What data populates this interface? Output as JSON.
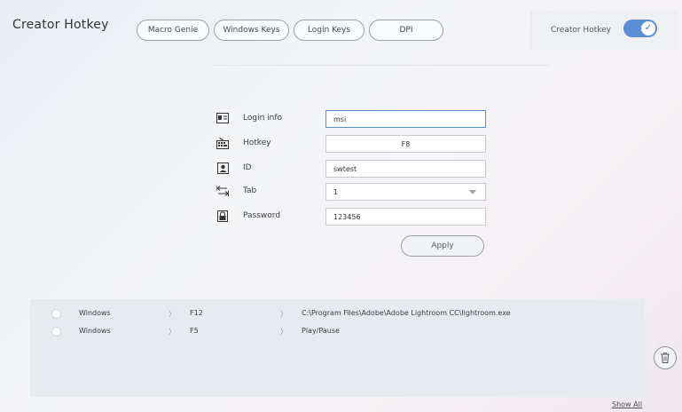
{
  "app": {
    "title": "Creator Hotkey"
  },
  "tabs": [
    {
      "label": "Macro Genie"
    },
    {
      "label": "Windows Keys"
    },
    {
      "label": "Login Keys"
    },
    {
      "label": "DPI"
    }
  ],
  "creator_toggle": {
    "label": "Creator Hotkey",
    "enabled": true,
    "check_glyph": "✓",
    "accent": "#5a8fd6"
  },
  "form": {
    "login_info": {
      "label": "Login info",
      "value": "msi",
      "icon": "id-card-icon"
    },
    "hotkey": {
      "label": "Hotkey",
      "value": "F8",
      "icon": "keyboard-icon"
    },
    "id": {
      "label": "ID",
      "value": "swtest",
      "icon": "user-icon"
    },
    "tab": {
      "label": "Tab",
      "value": "1",
      "icon": "tab-arrows-icon"
    },
    "password": {
      "label": "Password",
      "value": "123456",
      "icon": "lock-icon"
    },
    "apply_label": "Apply"
  },
  "list": {
    "rows": [
      {
        "type": "Windows",
        "sep": "〉",
        "key": "F12",
        "sep2": "〉",
        "action": "C:\\Program Files\\Adobe\\Adobe Lightroom CC\\lightroom.exe"
      },
      {
        "type": "Windows",
        "sep": "〉",
        "key": "F5",
        "sep2": "〉",
        "action": "Play/Pause"
      }
    ],
    "show_all_label": "Show All"
  }
}
